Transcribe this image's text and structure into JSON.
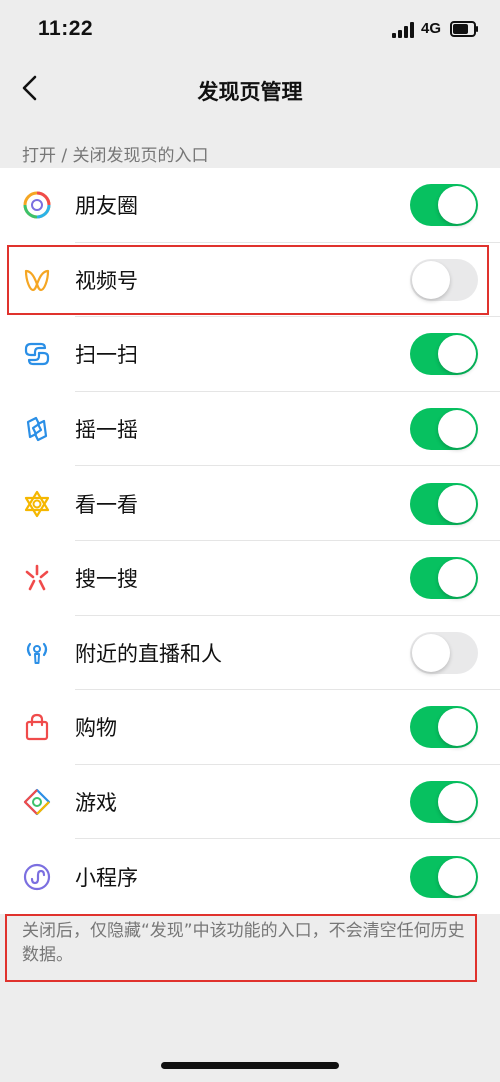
{
  "status_bar": {
    "time": "11:22",
    "network": "4G"
  },
  "nav": {
    "title": "发现页管理"
  },
  "section_header": "打开 / 关闭发现页的入口",
  "items": [
    {
      "label": "朋友圈",
      "icon": "moments-icon",
      "enabled": true
    },
    {
      "label": "视频号",
      "icon": "channels-icon",
      "enabled": false
    },
    {
      "label": "扫一扫",
      "icon": "scan-icon",
      "enabled": true
    },
    {
      "label": "摇一摇",
      "icon": "shake-icon",
      "enabled": true
    },
    {
      "label": "看一看",
      "icon": "top-stories-icon",
      "enabled": true
    },
    {
      "label": "搜一搜",
      "icon": "search-icon",
      "enabled": true
    },
    {
      "label": "附近的直播和人",
      "icon": "nearby-icon",
      "enabled": false
    },
    {
      "label": "购物",
      "icon": "shopping-bag-icon",
      "enabled": true
    },
    {
      "label": "游戏",
      "icon": "games-icon",
      "enabled": true
    },
    {
      "label": "小程序",
      "icon": "mini-programs-icon",
      "enabled": true
    }
  ],
  "footer_note": "关闭后，仅隐藏“发现”中该功能的入口，不会清空任何历史数据。",
  "colors": {
    "toggle_on": "#07c160",
    "toggle_off": "#e9e9ea",
    "highlight_border": "#e0322d"
  }
}
